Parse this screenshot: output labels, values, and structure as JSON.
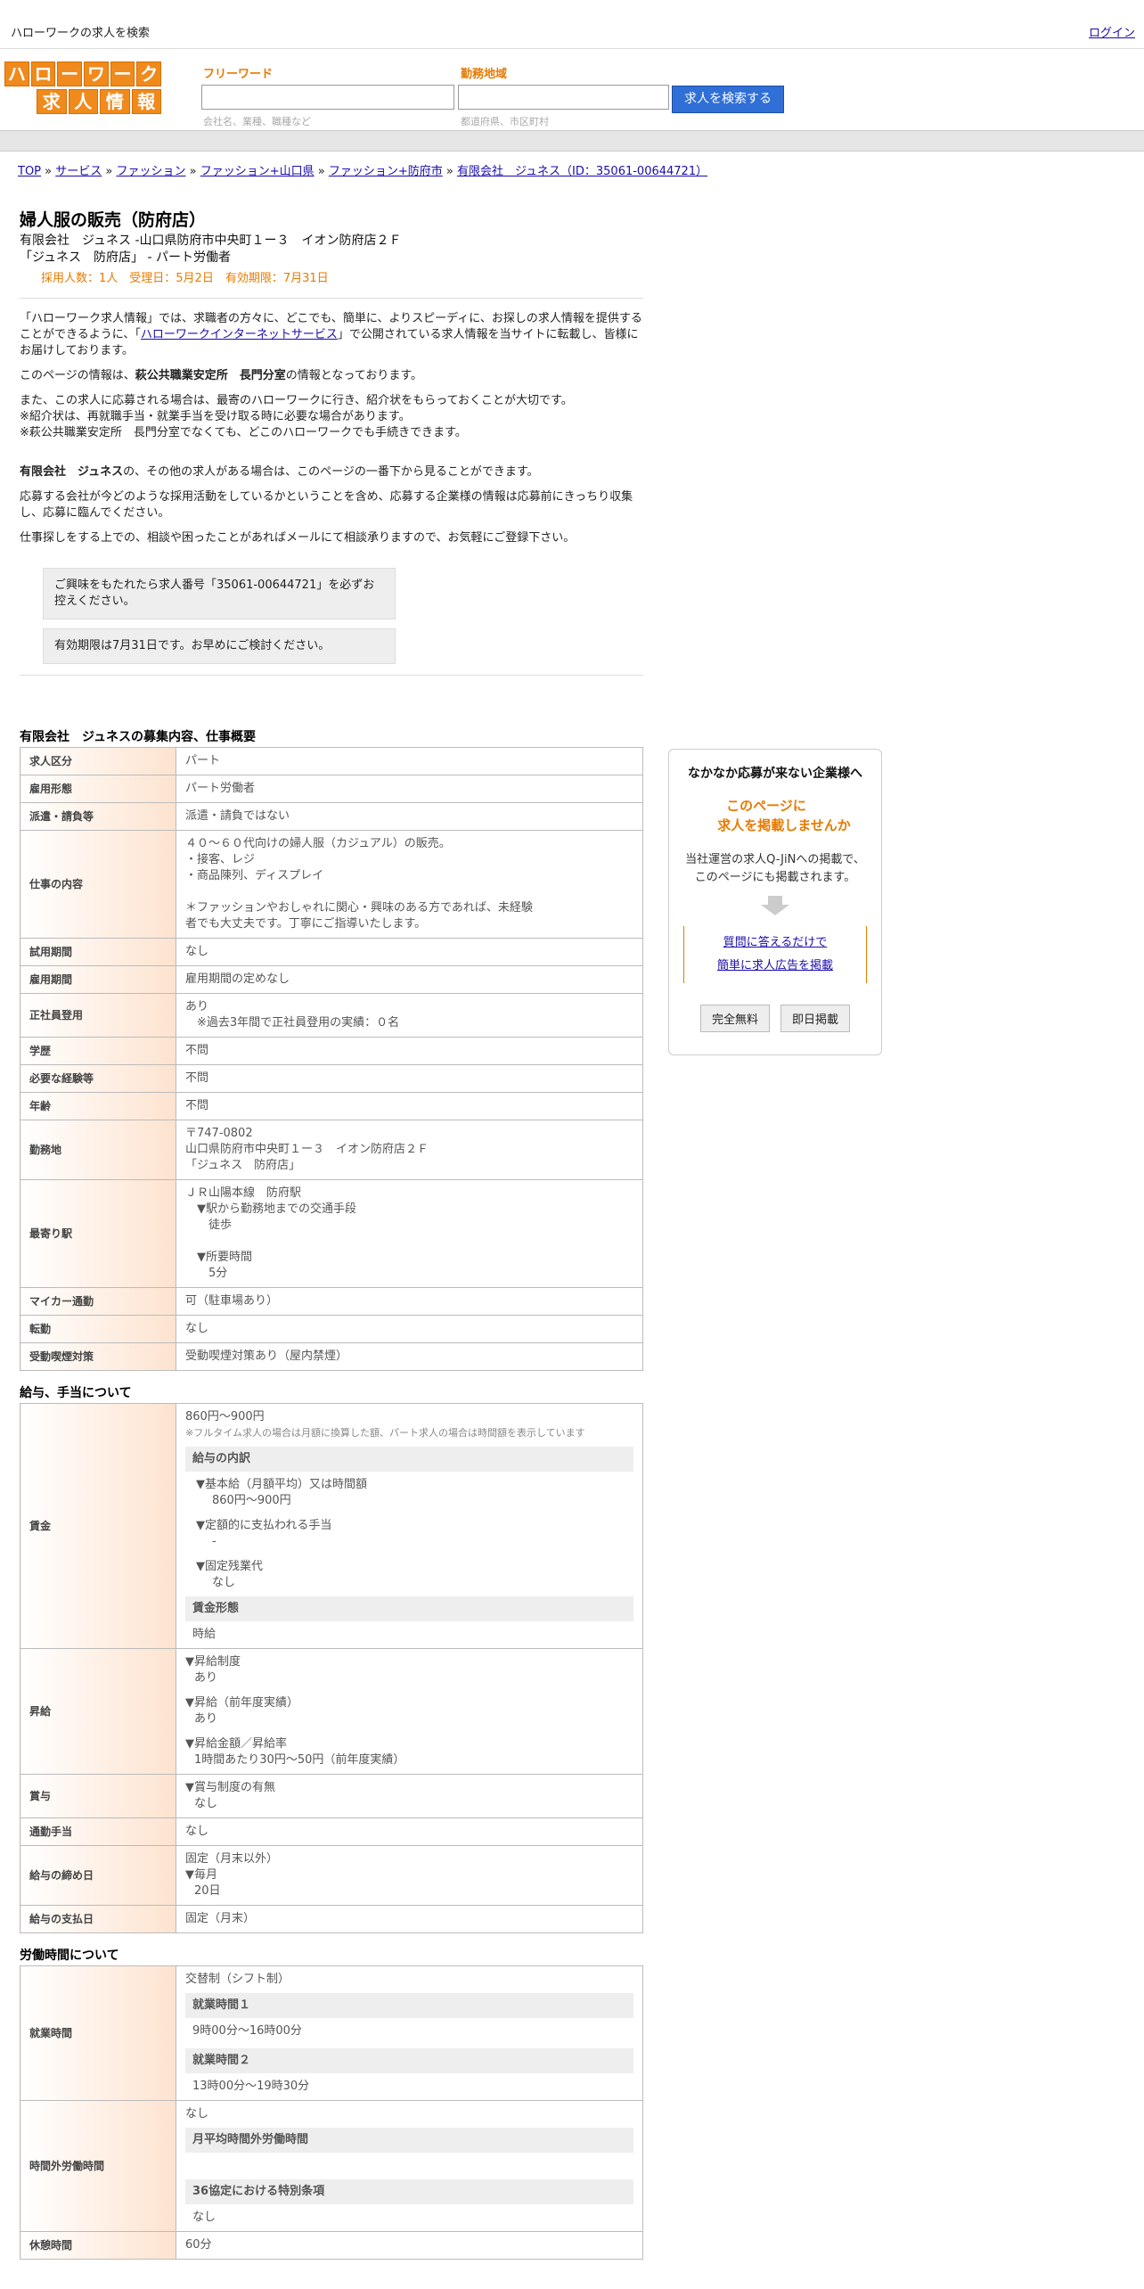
{
  "topbar": {
    "title": "ハローワークの求人を検索",
    "login": "ログイン"
  },
  "logo": {
    "row1": [
      "ハ",
      "ロ",
      "ー",
      "ワ",
      "ー",
      "ク"
    ],
    "row2": [
      "求",
      "人",
      "情",
      "報"
    ]
  },
  "search": {
    "freeword_label": "フリーワード",
    "freeword_hint": "会社名、業種、職種など",
    "area_label": "勤務地域",
    "area_hint": "都道府県、市区町村",
    "button": "求人を検索する"
  },
  "breadcrumb": [
    "TOP",
    "サービス",
    "ファッション",
    "ファッション+山口県",
    "ファッション+防府市",
    "有限会社　ジュネス（ID：35061-00644721）"
  ],
  "job": {
    "title": "婦人服の販売（防府店）",
    "company_line": "有限会社　ジュネス -山口県防府市中央町１ー３　イオン防府店２Ｆ",
    "store_line": "「ジュネス　防府店」 - パート労働者",
    "meta": "採用人数：1人　受理日：5月2日　有効期限：7月31日"
  },
  "intro": {
    "p1_a": "「ハローワーク求人情報」では、求職者の方々に、どこでも、簡単に、よりスピーディに、お探しの求人情報を提供することができるように、「",
    "p1_link": "ハローワークインターネットサービス",
    "p1_b": "」で公開されている求人情報を当サイトに転載し、皆様にお届けしております。",
    "p2_a": "このページの情報は、",
    "p2_bold": "萩公共職業安定所　長門分室",
    "p2_b": "の情報となっております。",
    "p3_1": "また、この求人に応募される場合は、最寄のハローワークに行き、紹介状をもらっておくことが大切です。",
    "p3_2": "※紹介状は、再就職手当・就業手当を受け取る時に必要な場合があります。",
    "p3_3": "※萩公共職業安定所　長門分室でなくても、どこのハローワークでも手続きできます。",
    "p4_bold": "有限会社　ジュネス",
    "p4_b": "の、その他の求人がある場合は、このページの一番下から見ることができます。",
    "p5": "応募する会社が今どのような採用活動をしているかということを含め、応募する企業様の情報は応募前にきっちり収集し、応募に臨んでください。",
    "p6": "仕事探しをする上での、相談や困ったことがあればメールにて相談承りますので、お気軽にご登録下さい。",
    "notice1": "ご興味をもたれたら求人番号「35061-00644721」を必ずお控えください。",
    "notice2": "有効期限は7月31日です。お早めにご検討ください。"
  },
  "overview": {
    "title": "有限会社　ジュネスの募集内容、仕事概要",
    "rows": [
      {
        "k": "求人区分",
        "v": [
          "パート"
        ]
      },
      {
        "k": "雇用形態",
        "v": [
          "パート労働者"
        ]
      },
      {
        "k": "派遣・請負等",
        "v": [
          "派遣・請負ではない"
        ]
      },
      {
        "k": "仕事の内容",
        "v": [
          "４０～６０代向けの婦人服（カジュアル）の販売。",
          "・接客、レジ",
          "・商品陳列、ディスプレイ",
          "",
          "＊ファッションやおしゃれに関心・興味のある方であれば、未経験",
          "者でも大丈夫です。丁寧にご指導いたします。"
        ]
      },
      {
        "k": "試用期間",
        "v": [
          "なし"
        ]
      },
      {
        "k": "雇用期間",
        "v": [
          "雇用期間の定めなし"
        ]
      },
      {
        "k": "正社員登用",
        "v": [
          "あり",
          "　※過去3年間で正社員登用の実績：０名"
        ]
      },
      {
        "k": "学歴",
        "v": [
          "不問"
        ]
      },
      {
        "k": "必要な経験等",
        "v": [
          "不問"
        ]
      },
      {
        "k": "年齢",
        "v": [
          "不問"
        ]
      },
      {
        "k": "勤務地",
        "v": [
          "〒747-0802",
          "山口県防府市中央町１ー３　イオン防府店２Ｆ",
          "「ジュネス　防府店」"
        ]
      },
      {
        "k": "最寄り駅",
        "v": [
          "ＪＲ山陽本線　防府駅",
          "　▼駅から勤務地までの交通手段",
          "　　徒歩",
          "",
          "　▼所要時間",
          "　　5分"
        ]
      },
      {
        "k": "マイカー通勤",
        "v": [
          "可（駐車場あり）"
        ]
      },
      {
        "k": "転勤",
        "v": [
          "なし"
        ]
      },
      {
        "k": "受動喫煙対策",
        "v": [
          "受動喫煙対策あり（屋内禁煙）"
        ]
      }
    ]
  },
  "salary": {
    "title": "給与、手当について",
    "wage_key": "賃金",
    "wage_value": "860円〜900円",
    "wage_note": "※フルタイム求人の場合は月額に換算した額、パート求人の場合は時間額を表示しています",
    "breakdown_h": "給与の内訳",
    "b1": "▼基本給（月額平均）又は時間額",
    "b1v": "860円〜900円",
    "b2": "▼定額的に支払われる手当",
    "b2v": "-",
    "b3": "▼固定残業代",
    "b3v": "なし",
    "form_h": "賃金形態",
    "form_v": "時給",
    "raise_key": "昇給",
    "r1": "▼昇給制度",
    "r1v": "あり",
    "r2": "▼昇給（前年度実績）",
    "r2v": "あり",
    "r3": "▼昇給金額／昇給率",
    "r3v": "1時間あたり30円〜50円（前年度実績）",
    "bonus_key": "賞与",
    "bo1": "▼賞与制度の有無",
    "bo1v": "なし",
    "commute_key": "通勤手当",
    "commute_v": "なし",
    "close_key": "給与の締め日",
    "close_v1": "固定（月末以外）",
    "close_v2": "▼毎月",
    "close_v3": "20日",
    "pay_key": "給与の支払日",
    "pay_v": "固定（月末）"
  },
  "hours": {
    "title": "労働時間について",
    "work_key": "就業時間",
    "work_v": "交替制（シフト制）",
    "h1": "就業時間１",
    "h1v": "9時00分〜16時00分",
    "h2": "就業時間２",
    "h2v": "13時00分〜19時30分",
    "ot_key": "時間外労働時間",
    "ot_v": "なし",
    "ot_h1": "月平均時間外労働時間",
    "ot_h1v": "",
    "ot_h2": "36協定における特別条項",
    "ot_h2v": "なし",
    "break_key": "休憩時間",
    "break_v": "60分"
  },
  "side": {
    "t1": "なかなか応募が来ない企業様へ",
    "t2a": "このページに",
    "t2b": "求人を掲載しませんか",
    "t3a": "当社運営の求人Q-JiNへの掲載で、",
    "t3b": "このページにも掲載されます。",
    "link1": "質問に答えるだけで",
    "link2": "簡単に求人広告を掲載",
    "btn1": "完全無料",
    "btn2": "即日掲載"
  }
}
